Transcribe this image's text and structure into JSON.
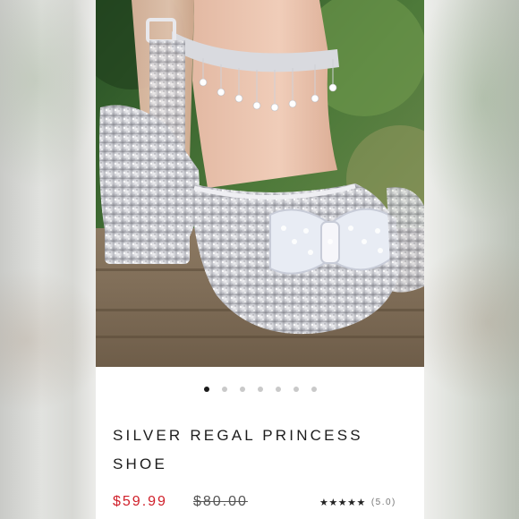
{
  "product": {
    "title": "SILVER REGAL PRINCESS SHOE",
    "price": "$59.99",
    "original_price": "$80.00",
    "rating_stars": "★★★★★",
    "rating_value": "(5.0)"
  },
  "carousel": {
    "total_slides": 7,
    "active_index": 1
  },
  "colors": {
    "price": "#d0202a",
    "active_dot": "#1a1a1a",
    "inactive_dot": "#c9c9c9"
  }
}
